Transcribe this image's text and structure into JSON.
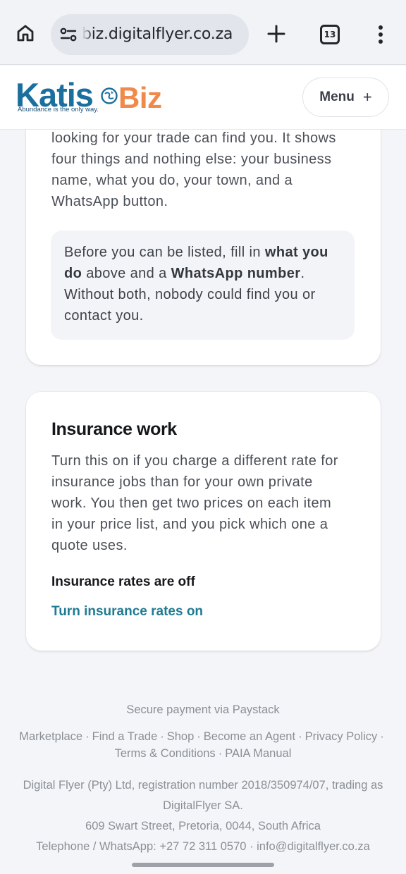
{
  "browser": {
    "url": "biz.digitalflyer.co.za",
    "tab_count": "13"
  },
  "header": {
    "logo_katis": "Katis",
    "logo_biz": "Biz",
    "logo_tagline": "Abundance is the only way.",
    "menu_label": "Menu",
    "menu_icon": "+"
  },
  "listing_card": {
    "lines": [
      "looking for your trade can find you. It shows",
      "four things and nothing else: your business",
      "name, what you do, your town, and a",
      "WhatsApp button."
    ],
    "notice": {
      "l1_pre": "Before you can be listed, fill in ",
      "l1_bold": "what you",
      "l2_bold": "do",
      "l2_mid": " above and a ",
      "l2_bold2": "WhatsApp number",
      "l2_end": ".",
      "l3": "Without both, nobody could find you or",
      "l4": "contact you."
    }
  },
  "insurance_card": {
    "title": "Insurance work",
    "lines": [
      "Turn this on if you charge a different rate for",
      "insurance jobs than for your own private",
      "work. You then get two prices on each item",
      "in your price list, and you pick which one a",
      "quote uses."
    ],
    "status": "Insurance rates are off",
    "action": "Turn insurance rates on"
  },
  "footer": {
    "payment": "Secure payment via Paystack",
    "links": [
      "Marketplace",
      "Find a Trade",
      "Shop",
      "Become an Agent",
      "Privacy Policy",
      "Terms & Conditions",
      "PAIA Manual"
    ],
    "separator": "·",
    "legal_1": "Digital Flyer (Pty) Ltd, registration number 2018/350974/07, trading as",
    "legal_2": "DigitalFlyer SA.",
    "address": "609 Swart Street, Pretoria, 0044, South Africa",
    "contact": "Telephone / WhatsApp: +27 72 311 0570 · info@digitalflyer.co.za"
  }
}
